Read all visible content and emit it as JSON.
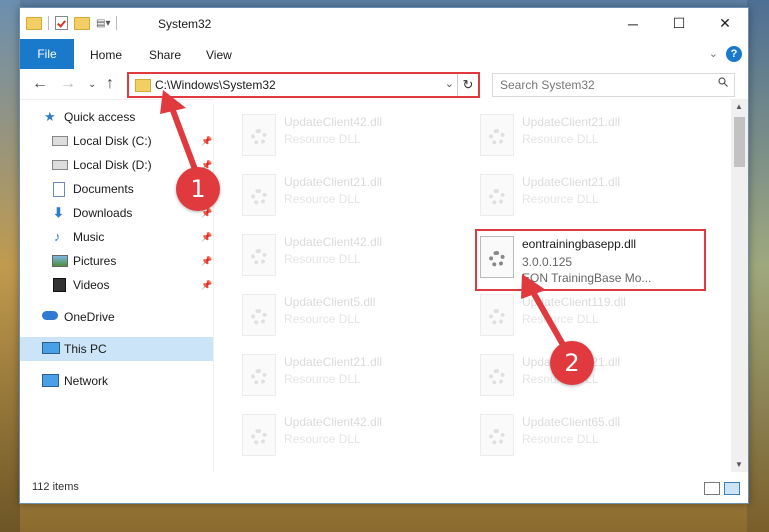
{
  "window": {
    "title": "System32"
  },
  "ribbon": {
    "tabs": [
      "File",
      "Home",
      "Share",
      "View"
    ],
    "help_label": "?"
  },
  "nav": {
    "address": "C:\\Windows\\System32",
    "search_placeholder": "Search System32",
    "refresh_glyph": "↻"
  },
  "sidebar": {
    "items": [
      {
        "label": "Quick access",
        "icon": "star-icon",
        "pinned": false
      },
      {
        "label": "Local Disk (C:)",
        "icon": "drive-icon",
        "pinned": true
      },
      {
        "label": "Local Disk (D:)",
        "icon": "drive-icon",
        "pinned": true
      },
      {
        "label": "Documents",
        "icon": "documents-icon",
        "pinned": true
      },
      {
        "label": "Downloads",
        "icon": "download-icon",
        "pinned": true
      },
      {
        "label": "Music",
        "icon": "music-icon",
        "pinned": true
      },
      {
        "label": "Pictures",
        "icon": "pictures-icon",
        "pinned": true
      },
      {
        "label": "Videos",
        "icon": "video-icon",
        "pinned": true
      },
      {
        "label": "OneDrive",
        "icon": "cloud-icon",
        "pinned": false
      },
      {
        "label": "This PC",
        "icon": "computer-icon",
        "pinned": false,
        "selected": true
      },
      {
        "label": "Network",
        "icon": "network-icon",
        "pinned": false
      }
    ]
  },
  "files": [
    {
      "name": "UpdateClient42.dll",
      "desc": "Resource DLL"
    },
    {
      "name": "UpdateClient21.dll",
      "desc": "Resource DLL"
    },
    {
      "name": "UpdateClient21.dll",
      "desc": "Resource DLL"
    },
    {
      "name": "UpdateClient21.dll",
      "desc": "Resource DLL"
    },
    {
      "name": "UpdateClient42.dll",
      "desc": "Resource DLL"
    },
    {
      "name": "eontrainingbasepp.dll",
      "desc": "3.0.0.125",
      "desc2": "EON TrainingBase Mo...",
      "highlighted": true
    },
    {
      "name": "UpdateClient5.dll",
      "desc": "Resource DLL"
    },
    {
      "name": "UpdateClient119.dll",
      "desc": "Resource DLL"
    },
    {
      "name": "UpdateClient21.dll",
      "desc": "Resource DLL"
    },
    {
      "name": "UpdateClient21.dll",
      "desc": "Resource DLL"
    },
    {
      "name": "UpdateClient42.dll",
      "desc": "Resource DLL"
    },
    {
      "name": "UpdateClient65.dll",
      "desc": "Resource DLL"
    }
  ],
  "status": {
    "item_count": "112 items"
  },
  "annotations": {
    "step1": "1",
    "step2": "2",
    "accent": "#e0393e"
  }
}
